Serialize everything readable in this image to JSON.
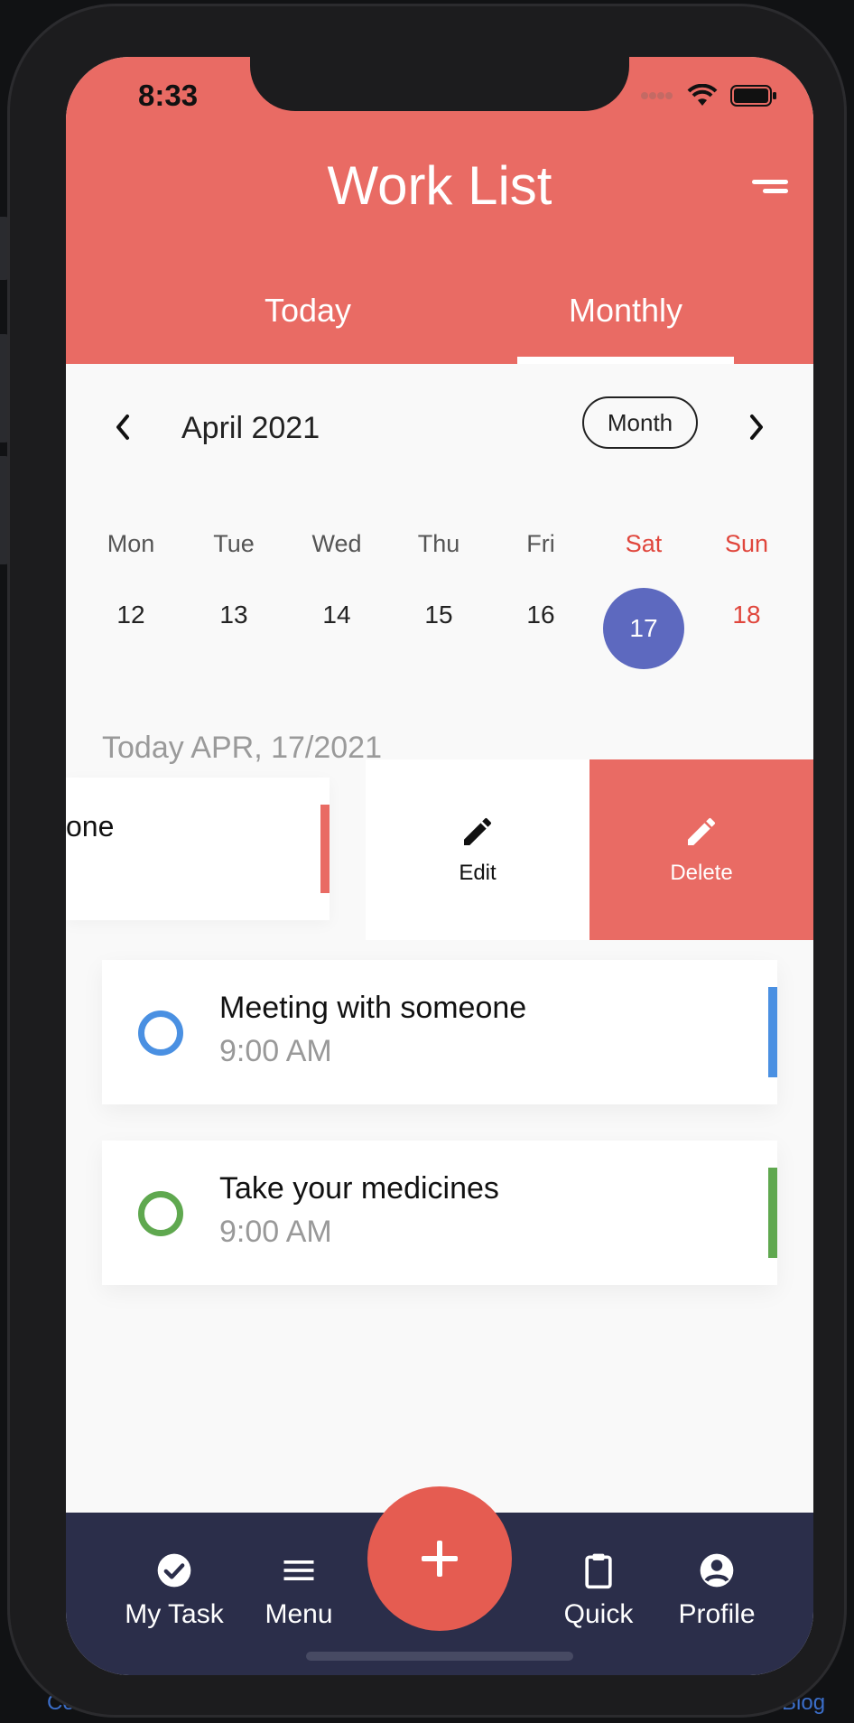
{
  "status": {
    "time": "8:33"
  },
  "header": {
    "title": "Work List"
  },
  "tabs": [
    {
      "label": "Today"
    },
    {
      "label": "Monthly"
    }
  ],
  "calendar": {
    "month_label": "April 2021",
    "view_button": "Month",
    "weekdays": [
      "Mon",
      "Tue",
      "Wed",
      "Thu",
      "Fri",
      "Sat",
      "Sun"
    ],
    "days": [
      "12",
      "13",
      "14",
      "15",
      "16",
      "17",
      "18"
    ],
    "selected_day": "17"
  },
  "date_heading": "Today APR, 17/2021",
  "swiped_task": {
    "partial_text": "one"
  },
  "swipe_actions": {
    "edit_label": "Edit",
    "delete_label": "Delete"
  },
  "tasks": [
    {
      "title": "Meeting with someone",
      "time": "9:00 AM",
      "color": "#4a90e2"
    },
    {
      "title": "Take your medicines",
      "time": "9:00 AM",
      "color": "#5fa84f"
    }
  ],
  "bottom_nav": {
    "my_task": "My Task",
    "menu": "Menu",
    "quick": "Quick",
    "profile": "Profile"
  },
  "background": {
    "link_left": "Co",
    "link_right": "Blog"
  },
  "colors": {
    "accent": "#e96b64",
    "selected_day": "#5d69bf",
    "nav_bg": "#2b2e4a",
    "fab": "#e55c51"
  }
}
